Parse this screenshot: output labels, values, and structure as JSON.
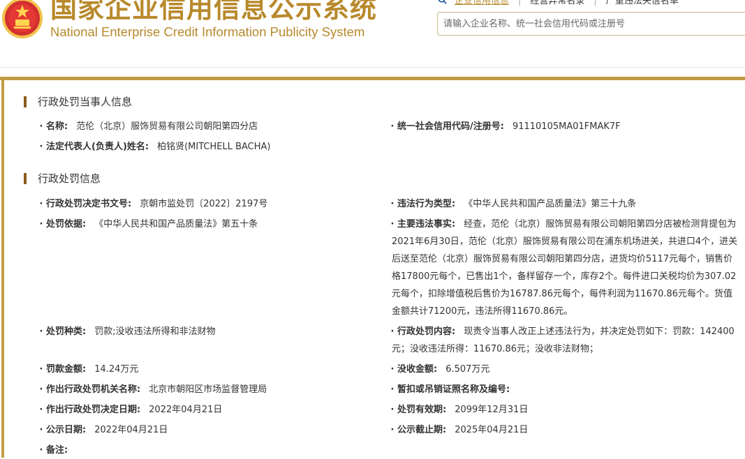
{
  "header": {
    "title_cn": "国家企业信用信息公示系统",
    "title_en": "National Enterprise Credit Information Publicity System",
    "nav": [
      "企业信用信息",
      "经营异常名录",
      "严重违法失信名单"
    ],
    "search_placeholder": "请输入企业名称、统一社会信用代码或注册号",
    "colors": {
      "brand": "#b8892c",
      "accent_bar": "#c29b42"
    }
  },
  "party_section": {
    "title": "行政处罚当事人信息",
    "fields": [
      {
        "label": "名称:",
        "value": "范伦（北京）服饰贸易有限公司朝阳第四分店"
      },
      {
        "label": "统一社会信用代码/注册号:",
        "value": "91110105MA01FMAK7F"
      },
      {
        "label": "法定代表人(负责人)姓名:",
        "value": "柏铭贤(MITCHELL BACHA)"
      }
    ]
  },
  "penalty_section": {
    "title": "行政处罚信息",
    "fields": [
      {
        "label": "行政处罚决定书文号:",
        "value": "京朝市监处罚〔2022〕2197号"
      },
      {
        "label": "违法行为类型:",
        "value": "《中华人民共和国产品质量法》第三十九条"
      },
      {
        "label": "处罚依据:",
        "value": "《中华人民共和国产品质量法》第五十条"
      },
      {
        "label": "主要违法事实:",
        "value": "经查，范伦（北京）服饰贸易有限公司朝阳第四分店被检测背提包为2021年6月30日，范伦（北京）服饰贸易有限公司在浦东机场进关，共进口4个，进关后送至范伦（北京）服饰贸易有限公司朝阳第四分店，进货均价5117元每个，销售价格17800元每个，已售出1个，备样留存一个，库存2个。每件进口关税均价为307.02元每个，扣除增值税后售价为16787.86元每个，每件利润为11670.86元每个。货值金额共计71200元，违法所得11670.86元。"
      },
      {
        "label": "处罚种类:",
        "value": "罚款;没收违法所得和非法财物"
      },
      {
        "label": "行政处罚内容:",
        "value": "现责令当事人改正上述违法行为，并决定处罚如下：罚款：142400元；没收违法所得：11670.86元；没收非法财物；"
      },
      {
        "label": "罚款金额:",
        "value": "14.24万元"
      },
      {
        "label": "没收金额:",
        "value": "6.507万元"
      },
      {
        "label": "作出行政处罚机关名称:",
        "value": "北京市朝阳区市场监督管理局"
      },
      {
        "label": "暂扣或吊销证照名称及编号:",
        "value": ""
      },
      {
        "label": "作出行政处罚决定日期:",
        "value": "2022年04月21日"
      },
      {
        "label": "处罚有效期:",
        "value": "2099年12月31日"
      },
      {
        "label": "公示日期:",
        "value": "2022年04月21日"
      },
      {
        "label": "公示截止期:",
        "value": "2025年04月21日"
      },
      {
        "label": "备注:",
        "value": ""
      }
    ]
  }
}
